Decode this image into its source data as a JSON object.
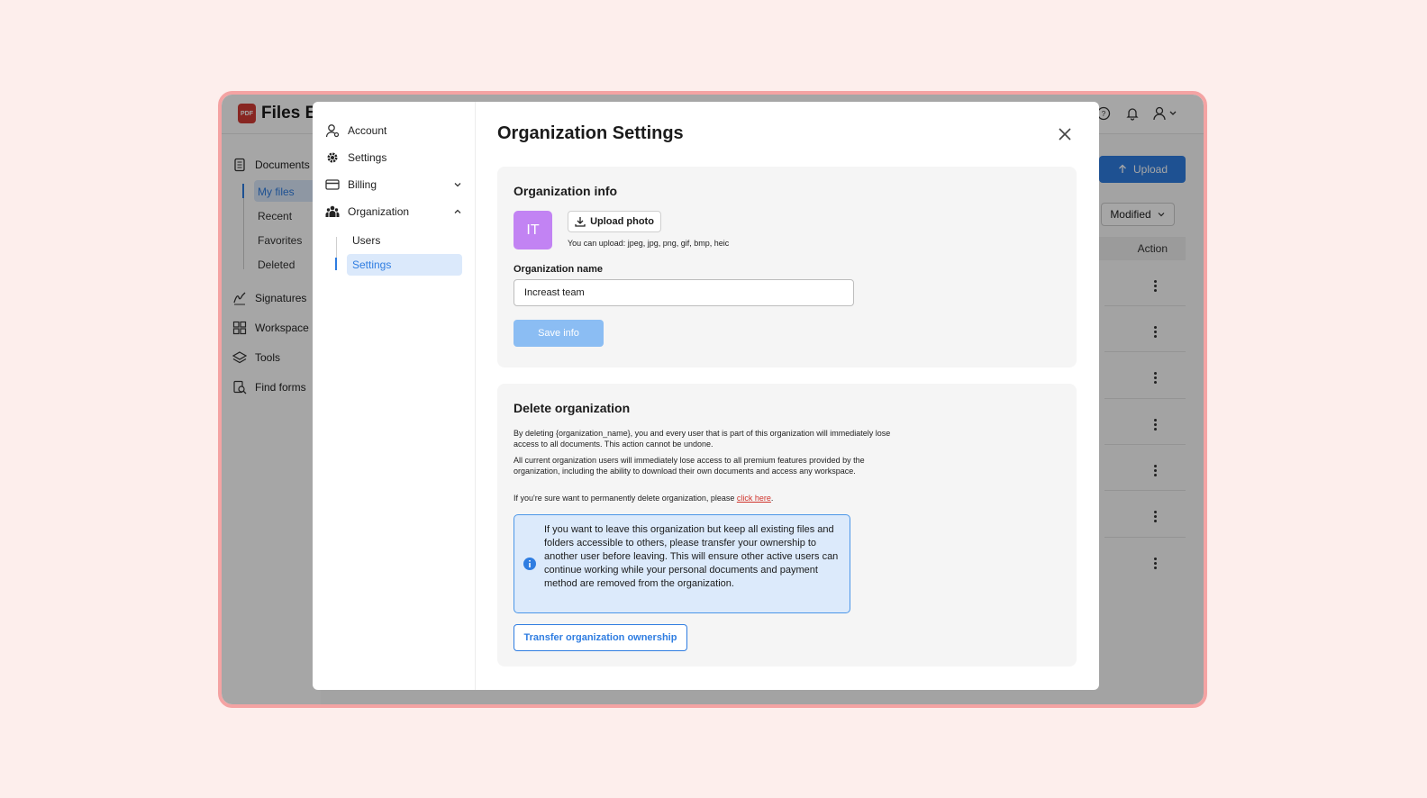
{
  "app": {
    "logo_badge": "PDF",
    "logo_text": "Files Ed",
    "upload_label": "Upload",
    "modified_label": "Modified",
    "action_header": "Action",
    "sidebar": {
      "items": [
        {
          "label": "Documents",
          "icon": "document-icon"
        },
        {
          "label": "Signatures",
          "icon": "signature-icon"
        },
        {
          "label": "Workspace",
          "icon": "workspace-icon"
        },
        {
          "label": "Tools",
          "icon": "layers-icon"
        },
        {
          "label": "Find forms",
          "icon": "find-forms-icon"
        }
      ],
      "sub_items": [
        "My files",
        "Recent",
        "Favorites",
        "Deleted"
      ]
    }
  },
  "modal": {
    "title": "Organization Settings",
    "nav": {
      "account": "Account",
      "settings": "Settings",
      "billing": "Billing",
      "organization": "Organization",
      "org_users": "Users",
      "org_settings": "Settings"
    },
    "org_info": {
      "title": "Organization info",
      "avatar_initials": "IT",
      "upload_photo": "Upload photo",
      "upload_hint": "You can upload: jpeg, jpg, png, gif, bmp, heic",
      "name_label": "Organization name",
      "name_value": "Increast team",
      "save_label": "Save info"
    },
    "delete_org": {
      "title": "Delete organization",
      "para1": "By deleting {organization_name}, you and every user that is part of this organization will immediately lose access to all documents. This action cannot be undone.",
      "para2": "All current organization users will immediately lose access to all premium features provided by the organization, including the ability to download their own documents and access any workspace.",
      "para3_prefix": "If you're sure want to permanently delete organization, please ",
      "para3_link": "click here",
      "para3_suffix": ".",
      "info_text": "If you want to leave this organization but keep all existing files and folders accessible to others, please transfer your ownership to another user before leaving. This will ensure other active users can continue working while your personal documents and payment method are removed from the organization.",
      "transfer_label": "Transfer organization ownership"
    }
  },
  "colors": {
    "accent": "#2f7de1",
    "frame_border": "#f4a3a3",
    "page_bg": "#fdeeec",
    "avatar": "#c283f3",
    "link": "#d0342c"
  }
}
